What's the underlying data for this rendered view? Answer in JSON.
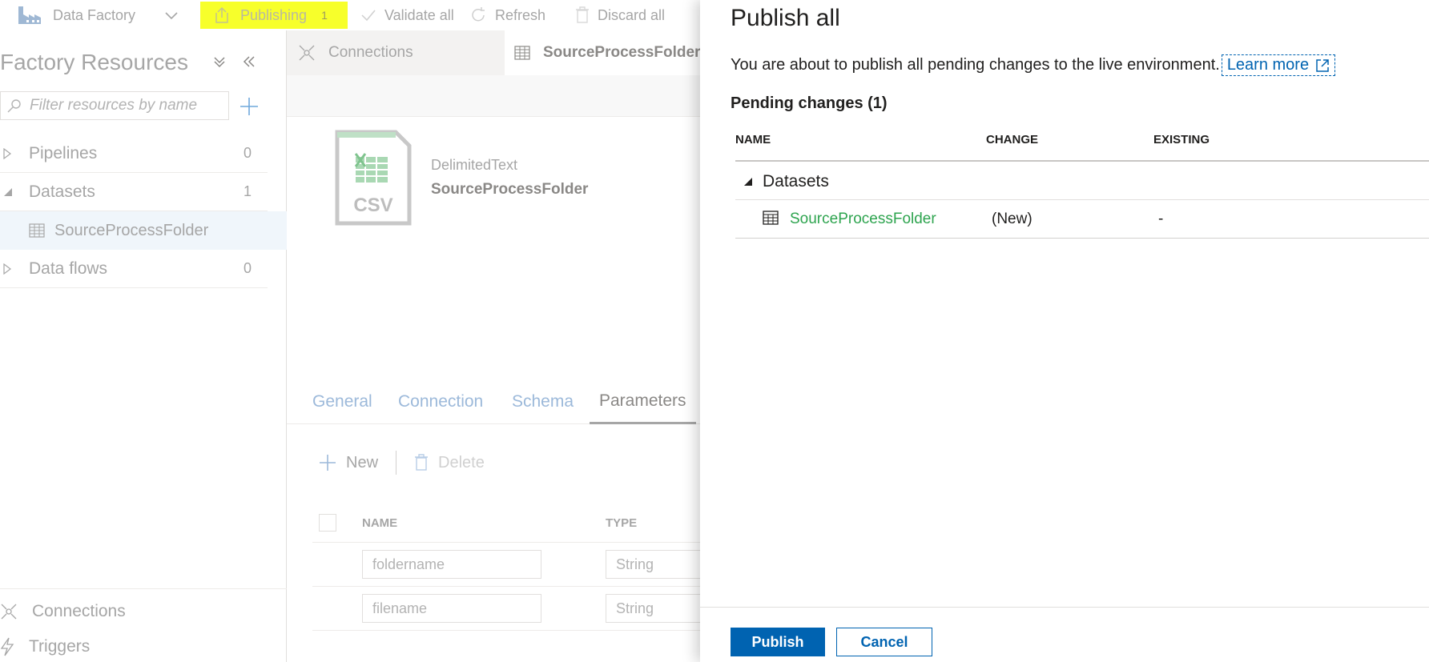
{
  "toolbar": {
    "brand_label": "Data Factory",
    "publishing_label": "Publishing",
    "publishing_count": "1",
    "validate_label": "Validate all",
    "refresh_label": "Refresh",
    "discard_label": "Discard all",
    "highlight_color": "#f7ff2b"
  },
  "sidebar": {
    "title": "Factory Resources",
    "search_placeholder": "Filter resources by name",
    "tree": [
      {
        "label": "Pipelines",
        "count": "0",
        "expanded": false
      },
      {
        "label": "Datasets",
        "count": "1",
        "expanded": true
      },
      {
        "label": "Data flows",
        "count": "0",
        "expanded": false
      }
    ],
    "dataset_child": "SourceProcessFolder",
    "bottom": [
      {
        "label": "Connections",
        "icon": "connections-icon"
      },
      {
        "label": "Triggers",
        "icon": "lightning-icon"
      }
    ]
  },
  "main": {
    "tabs": [
      {
        "label": "Connections",
        "icon": "connections-icon"
      },
      {
        "label": "SourceProcessFolder",
        "icon": "table-icon"
      }
    ],
    "dataset": {
      "icon_text": "CSV",
      "type": "DelimitedText",
      "name": "SourceProcessFolder"
    },
    "property_tabs": [
      "General",
      "Connection",
      "Schema",
      "Parameters"
    ],
    "active_property_tab": "Parameters",
    "actions": {
      "new_label": "New",
      "delete_label": "Delete"
    },
    "param_columns": [
      "NAME",
      "TYPE"
    ],
    "params": [
      {
        "name": "foldername",
        "type": "String"
      },
      {
        "name": "filename",
        "type": "String"
      }
    ]
  },
  "panel": {
    "title": "Publish all",
    "description": "You are about to publish all pending changes to the live environment.",
    "learn_more": "Learn more",
    "pending_label": "Pending changes (1)",
    "columns": [
      "NAME",
      "CHANGE",
      "EXISTING"
    ],
    "group": "Datasets",
    "items": [
      {
        "name": "SourceProcessFolder",
        "change": "(New)",
        "existing": "-"
      }
    ],
    "publish_label": "Publish",
    "cancel_label": "Cancel",
    "accent_color": "#0063b1",
    "new_item_color": "#2ea44f"
  }
}
